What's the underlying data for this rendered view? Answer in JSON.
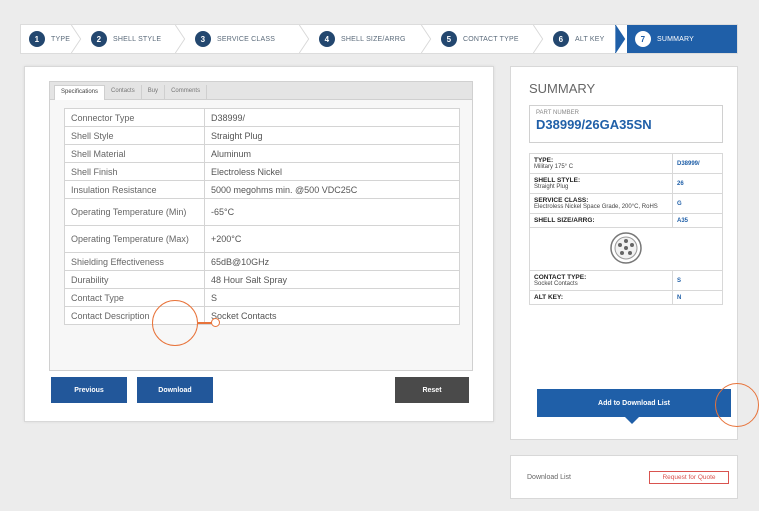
{
  "stepper": {
    "steps": [
      {
        "num": "1",
        "label": "TYPE"
      },
      {
        "num": "2",
        "label": "SHELL STYLE"
      },
      {
        "num": "3",
        "label": "SERVICE CLASS"
      },
      {
        "num": "4",
        "label": "SHELL SIZE/ARRG"
      },
      {
        "num": "5",
        "label": "CONTACT TYPE"
      },
      {
        "num": "6",
        "label": "ALT KEY"
      },
      {
        "num": "7",
        "label": "SUMMARY"
      }
    ],
    "active_index": 6,
    "colors": {
      "active": "#1f5fa8",
      "badge": "#23476f"
    }
  },
  "tabs": [
    "Specifications",
    "Contacts",
    "Buy",
    "Comments"
  ],
  "specs": [
    {
      "key": "Connector Type",
      "value": "D38999/"
    },
    {
      "key": "Shell Style",
      "value": "Straight Plug"
    },
    {
      "key": "Shell Material",
      "value": "Aluminum"
    },
    {
      "key": "Shell Finish",
      "value": "Electroless Nickel"
    },
    {
      "key": "Insulation Resistance",
      "value": "5000 megohms min. @500 VDC25C"
    },
    {
      "key": "Operating Temperature (Min)",
      "value": "-65°C"
    },
    {
      "key": "Operating Temperature (Max)",
      "value": "+200°C"
    },
    {
      "key": "Shielding Effectiveness",
      "value": "65dB@10GHz"
    },
    {
      "key": "Durability",
      "value": "48 Hour Salt Spray"
    },
    {
      "key": "Contact Type",
      "value": "S"
    },
    {
      "key": "Contact Description",
      "value": "Socket Contacts"
    }
  ],
  "buttons": {
    "previous": "Previous",
    "download": "Download",
    "reset": "Reset"
  },
  "summary": {
    "title": "SUMMARY",
    "part_label": "PART NUMBER",
    "part_number": "D38999/26GA35SN",
    "rows": [
      {
        "label": "TYPE:",
        "sub": "Military 175° C",
        "value": "D38999/"
      },
      {
        "label": "SHELL STYLE:",
        "sub": "Straight Plug",
        "value": "26"
      },
      {
        "label": "SERVICE CLASS:",
        "sub": "Electroless Nickel Space Grade, 200°C, RoHS",
        "value": "G"
      },
      {
        "label": "SHELL SIZE/ARRG:",
        "sub": "",
        "value": "A35"
      },
      {
        "label": "CONTACT TYPE:",
        "sub": "Socket Contacts",
        "value": "S"
      },
      {
        "label": "ALT KEY:",
        "sub": "",
        "value": "N"
      }
    ],
    "add_button": "Add to Download List"
  },
  "download_list": {
    "label": "Download List",
    "request_quote": "Request for Quote"
  },
  "colors": {
    "primary": "#1f5fa8",
    "highlight_ring": "#e8733a",
    "reset": "#4a4a4a"
  }
}
